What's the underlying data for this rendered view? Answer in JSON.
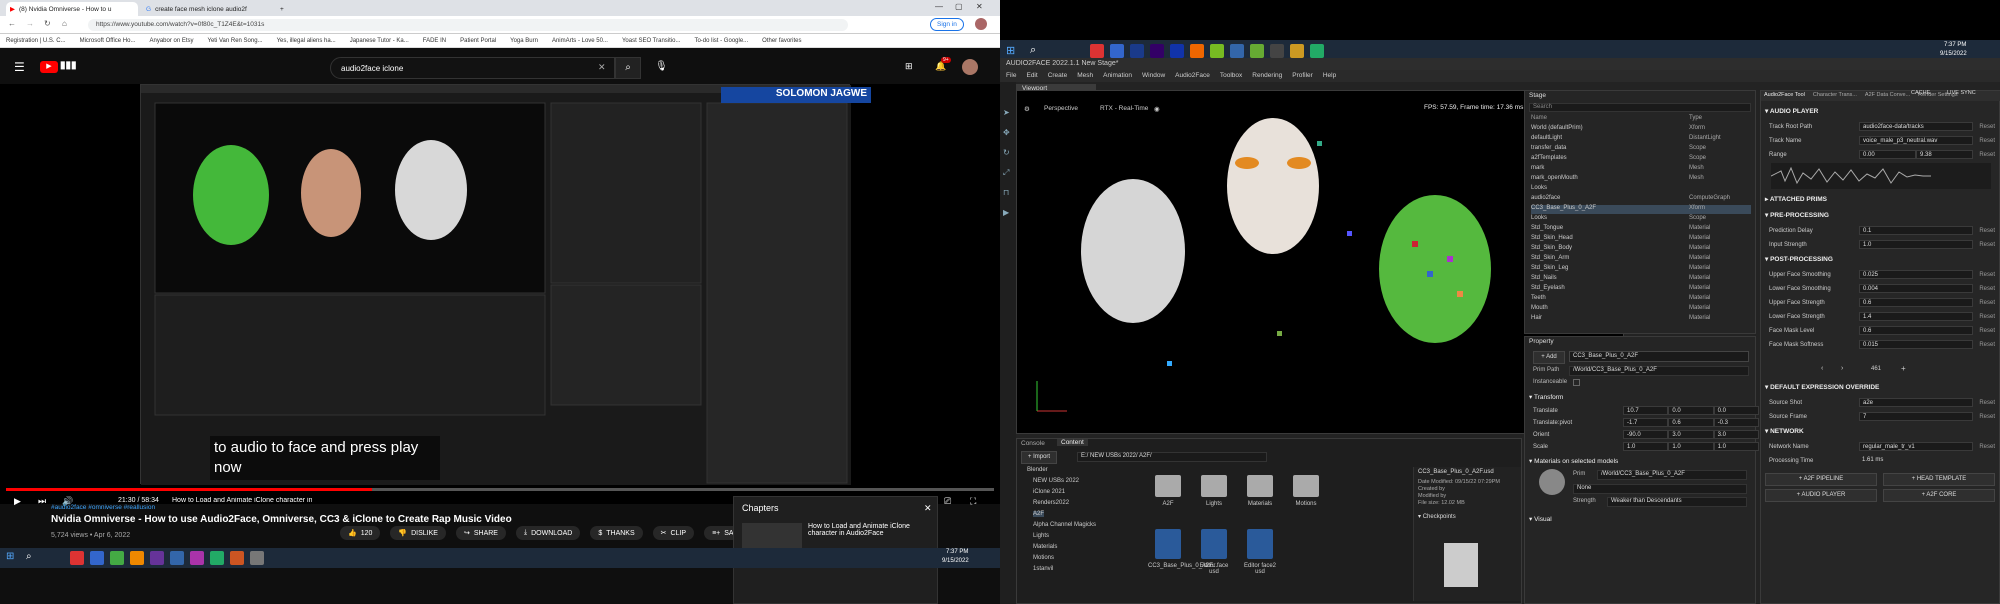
{
  "browser": {
    "tabs": [
      "(8) Nvidia Omniverse - How to u",
      "create face mesh iclone audio2f"
    ],
    "url": "https://www.youtube.com/watch?v=0f80c_T1Z4E&t=1031s",
    "signin": "Sign in",
    "bookmarks": [
      "Registration | U.S. C...",
      "Microsoft Office Ho...",
      "Anyabor on Etsy",
      "Yeti Van Ren Song...",
      "Yes, illegal aliens ha...",
      "Japanese Tutor - Ka...",
      "FADE IN",
      "Patient Portal",
      "Yoga Burn",
      "AnimArts - Love 50...",
      "Yoast SEO Transitio...",
      "To-do list - Google...",
      "Other favorites"
    ]
  },
  "youtube": {
    "search_value": "audio2face iclone",
    "badge_count": "9+",
    "caption": "to audio to face and press play now",
    "channel_overlay": "SOLOMON JAGWE",
    "time": "21:30 / 58:34",
    "chapter_now": "How to Load and Animate iClone character in Audio2Face",
    "progress_fraction": 0.37,
    "hashtags": "#audio2face #omniverse #reallusion",
    "title": "Nvidia Omniverse - How to use Audio2Face, Omniverse, CC3 & iClone to Create Rap Music Video",
    "meta": "5,724 views • Apr 6, 2022",
    "likes": "120",
    "dislike": "DISLIKE",
    "share": "SHARE",
    "download": "DOWNLOAD",
    "thanks": "THANKS",
    "clip": "CLIP",
    "save": "SAVE",
    "chapters_title": "Chapters",
    "chapter_item": "How to Load and Animate iClone character in Audio2Face"
  },
  "taskbar": {
    "time": "7:37 PM",
    "date": "9/15/2022"
  },
  "a2f": {
    "window_title": "AUDIO2FACE  2022.1.1  New Stage*",
    "menus": [
      "File",
      "Edit",
      "Create",
      "Mesh",
      "Animation",
      "Window",
      "Audio2Face",
      "Toolbox",
      "Rendering",
      "Profiler",
      "Help"
    ],
    "viewport_tab": "Viewport",
    "camera": "Perspective",
    "renderer": "RTX - Real-Time",
    "fps": "FPS: 57.59, Frame time: 17.36 ms",
    "stage_tab": "Stage",
    "stage_search": "Search",
    "stage_cols": [
      "Name",
      "Type"
    ],
    "stage_tree": [
      {
        "name": "World (defaultPrim)",
        "type": "Xform"
      },
      {
        "name": "defaultLight",
        "type": "DistantLight"
      },
      {
        "name": "transfer_data",
        "type": "Scope"
      },
      {
        "name": "a2fTemplates",
        "type": "Scope"
      },
      {
        "name": "mark",
        "type": "Mesh"
      },
      {
        "name": "mark_openMouth",
        "type": "Mesh"
      },
      {
        "name": "Looks",
        "type": ""
      },
      {
        "name": "audio2face",
        "type": "ComputeGraph"
      },
      {
        "name": "CC3_Base_Plus_0_A2F",
        "type": "Xform"
      },
      {
        "name": "Looks",
        "type": "Scope"
      },
      {
        "name": "Std_Tongue",
        "type": "Material"
      },
      {
        "name": "Std_Skin_Head",
        "type": "Material"
      },
      {
        "name": "Std_Skin_Body",
        "type": "Material"
      },
      {
        "name": "Std_Skin_Arm",
        "type": "Material"
      },
      {
        "name": "Std_Skin_Leg",
        "type": "Material"
      },
      {
        "name": "Std_Nails",
        "type": "Material"
      },
      {
        "name": "Std_Eyelash",
        "type": "Material"
      },
      {
        "name": "Teeth",
        "type": "Material"
      },
      {
        "name": "Mouth",
        "type": "Material"
      },
      {
        "name": "Hair",
        "type": "Material"
      }
    ],
    "property_tab": "Property",
    "add_btn": "Add",
    "prim_name": "CC3_Base_Plus_0_A2F",
    "prim_path_label": "Prim Path",
    "prim_path": "/World/CC3_Base_Plus_0_A2F",
    "instanceable_label": "Instanceable",
    "transform_label": "Transform",
    "translate_label": "Translate",
    "translate": [
      "10.7",
      "0.0",
      "0.0"
    ],
    "pivot_label": "Translate:pivot",
    "pivot": [
      "-1.7",
      "0.6",
      "-0.3"
    ],
    "orient_label": "Orient",
    "orient": [
      "-90.0",
      "3.0",
      "3.0"
    ],
    "scale_label": "Scale",
    "scale": [
      "1.0",
      "1.0",
      "1.0"
    ],
    "materials_label": "Materials on selected models",
    "prim_label": "Prim",
    "prim_val": "/World/CC3_Base_Plus_0_A2F",
    "none_val": "None",
    "strength_label": "Strength",
    "strength_val": "Weaker than Descendants",
    "visual_label": "Visual",
    "console_tab": "Console",
    "content_tab": "Content",
    "import_btn": "Import",
    "content_path": "E:/ NEW USBs 2022/ A2F/",
    "content_tree": [
      "Blender",
      "NEW USBs 2022",
      "iClone 2021",
      "Renders2022",
      "A2F",
      "Alpha Channel Magicks",
      "Lights",
      "Materials",
      "Motions",
      "1stanvil"
    ],
    "folders": [
      "A2F",
      "Lights",
      "Materials",
      "Motions"
    ],
    "files": [
      "CC3_Base_Plus_0_A2F...",
      "Editor face usd",
      "Editor face2 usd"
    ],
    "file_info_name": "CC3_Base_Plus_0_A2F.usd",
    "file_info": [
      "Date Modified: 09/15/22 07:29PM",
      "Created by",
      "Modified by",
      "File size: 12.02 MB"
    ],
    "checkpoints": "Checkpoints",
    "panel_tabs": [
      "Audio2Face Tool",
      "Character Trans...",
      "A2F Data Conve...",
      "Render Settings"
    ],
    "audio_player": "AUDIO PLAYER",
    "track_root_label": "Track Root Path",
    "track_root": "audio2face-data/tracks",
    "track_name_label": "Track Name",
    "track_name": "voice_male_p3_neutral.wav",
    "range_label": "Range",
    "range": [
      "0.00",
      "9.38"
    ],
    "cache": "CACHE",
    "live_sync": "LIVE SYNC",
    "attached_prims": "ATTACHED PRIMS",
    "preprocessing": "PRE-PROCESSING",
    "prediction_delay_label": "Prediction Delay",
    "prediction_delay": "0.1",
    "input_strength_label": "Input Strength",
    "input_strength": "1.0",
    "postprocessing": "POST-PROCESSING",
    "post": [
      {
        "label": "Upper Face Smoothing",
        "value": "0.025"
      },
      {
        "label": "Lower Face Smoothing",
        "value": "0.004"
      },
      {
        "label": "Upper Face Strength",
        "value": "0.6"
      },
      {
        "label": "Lower Face Strength",
        "value": "1.4"
      },
      {
        "label": "Face Mask Level",
        "value": "0.6"
      },
      {
        "label": "Face Mask Softness",
        "value": "0.015"
      }
    ],
    "frame_num": "461",
    "default_expr": "DEFAULT EXPRESSION OVERRIDE",
    "source_shot_label": "Source Shot",
    "source_shot": "a2e",
    "source_frame_label": "Source Frame",
    "source_frame": "7",
    "network": "NETWORK",
    "network_name_label": "Network Name",
    "network_name": "regular_male_tr_v1",
    "processing_time_label": "Processing Time",
    "processing_time": "1.61 ms",
    "reset": "Reset",
    "btn_pipeline": "+ A2F PIPELINE",
    "btn_head": "+ HEAD TEMPLATE",
    "btn_audio": "+ AUDIO PLAYER",
    "btn_core": "+ A2F CORE"
  }
}
